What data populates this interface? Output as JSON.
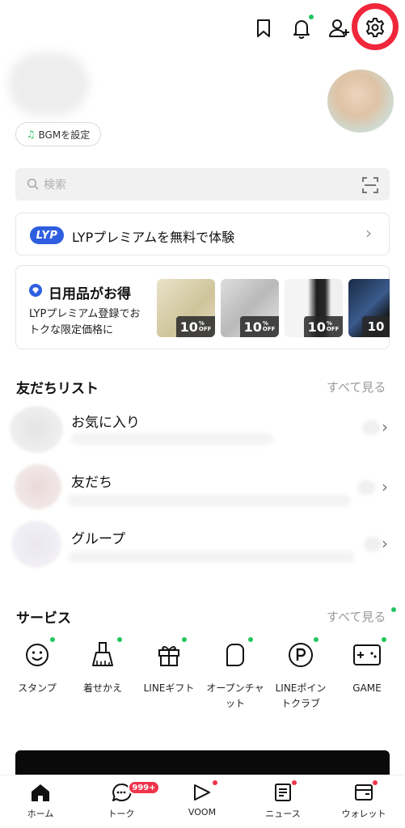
{
  "header": {
    "icons": [
      "bookmark-icon",
      "bell-icon",
      "add-friend-icon",
      "gear-icon"
    ],
    "highlight_color": "#f0263a"
  },
  "profile": {
    "bgm_label": "BGMを設定"
  },
  "search": {
    "placeholder": "検索"
  },
  "lyp_banner": {
    "badge": "LYP",
    "text": "LYPプレミアムを無料で体験"
  },
  "promo": {
    "title": "日用品がお得",
    "description": "LYPプレミアム登録でおトクな限定価格に",
    "items": [
      {
        "discount": "10",
        "unit": "%",
        "off": "OFF"
      },
      {
        "discount": "10",
        "unit": "%",
        "off": "OFF"
      },
      {
        "discount": "10",
        "unit": "%",
        "off": "OFF"
      },
      {
        "discount": "10",
        "unit": "",
        "off": ""
      }
    ]
  },
  "friends": {
    "title": "友だちリスト",
    "see_all": "すべて見る",
    "rows": [
      {
        "label": "お気に入り"
      },
      {
        "label": "友だち"
      },
      {
        "label": "グループ"
      }
    ]
  },
  "services": {
    "title": "サービス",
    "see_all": "すべて見る",
    "items": [
      {
        "label": "スタンプ",
        "icon": "smile-icon"
      },
      {
        "label": "着せかえ",
        "icon": "brush-icon"
      },
      {
        "label": "LINEギフト",
        "icon": "gift-icon"
      },
      {
        "label": "オープンチャット",
        "icon": "open-chat-icon"
      },
      {
        "label": "LINEポイントクラブ",
        "icon": "points-icon"
      },
      {
        "label": "GAME",
        "icon": "gamepad-icon"
      }
    ]
  },
  "bottom_nav": {
    "items": [
      {
        "label": "ホーム",
        "icon": "home-icon"
      },
      {
        "label": "トーク",
        "icon": "chat-icon"
      },
      {
        "label": "VOOM",
        "icon": "voom-icon"
      },
      {
        "label": "ニュース",
        "icon": "news-icon"
      },
      {
        "label": "ウォレット",
        "icon": "wallet-icon"
      }
    ],
    "talk_badge": "999+"
  }
}
